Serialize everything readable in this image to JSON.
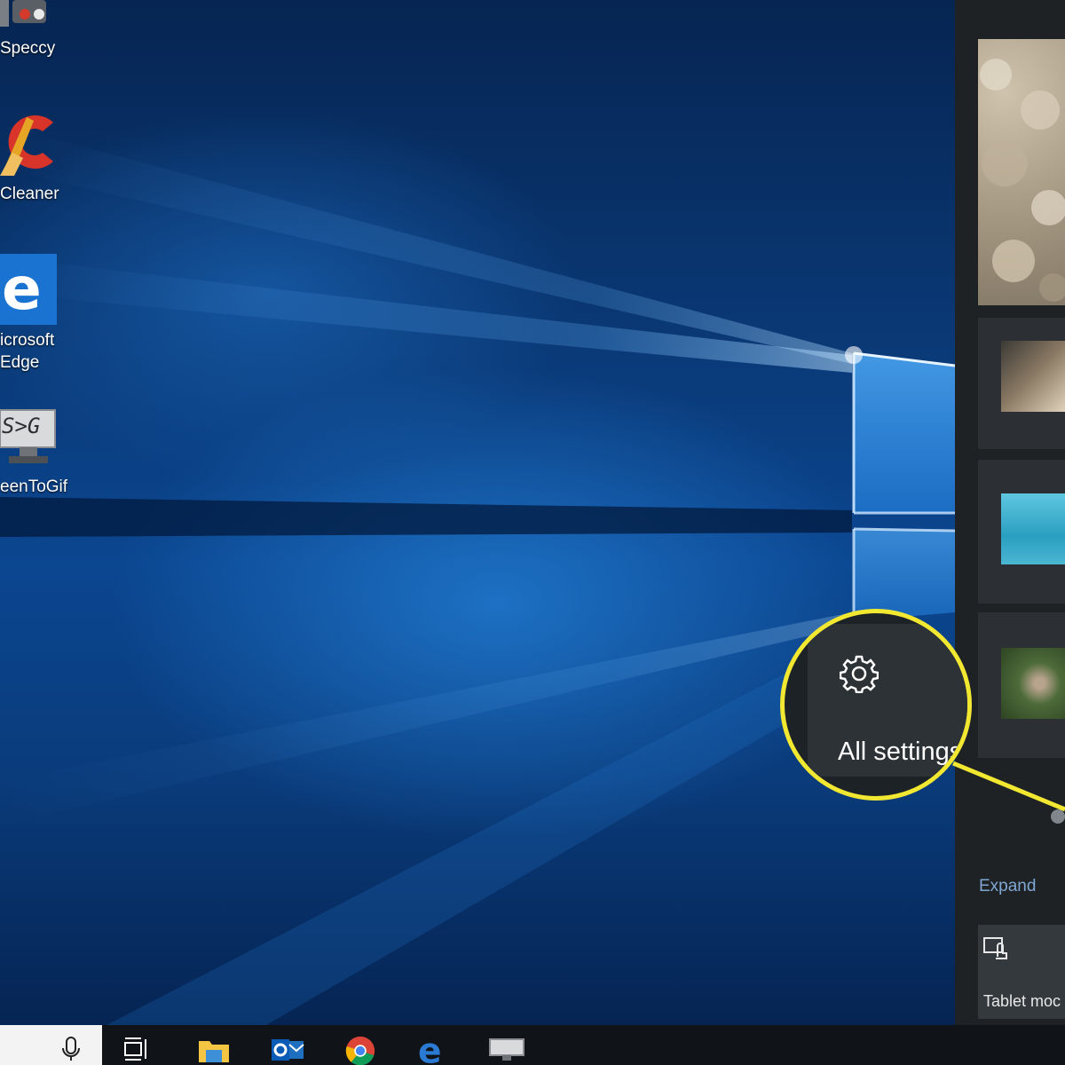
{
  "desktop": {
    "icons": [
      {
        "name": "Speccy",
        "label_lines": [
          "Speccy"
        ]
      },
      {
        "name": "CCleaner",
        "label_lines": [
          "Cleaner"
        ]
      },
      {
        "name": "Microsoft Edge",
        "label_lines": [
          "icrosoft",
          "Edge"
        ]
      },
      {
        "name": "ScreenToGif",
        "label_lines": [
          "eenToGif"
        ],
        "glyph_text": "S>G"
      }
    ]
  },
  "action_center": {
    "expand_label": "Expand",
    "quick_actions": [
      {
        "label": "Tablet moc",
        "icon": "tablet-mode-icon"
      }
    ]
  },
  "callout": {
    "label": "All settings",
    "icon": "gear-icon",
    "ring_color": "#f2e832"
  },
  "taskbar": {
    "apps": [
      "microphone-icon",
      "task-view-icon",
      "file-explorer-icon",
      "outlook-icon",
      "chrome-icon",
      "edge-icon",
      "screentogif-icon"
    ]
  },
  "colors": {
    "accent": "#f2e832",
    "link": "#7fa7d2"
  }
}
